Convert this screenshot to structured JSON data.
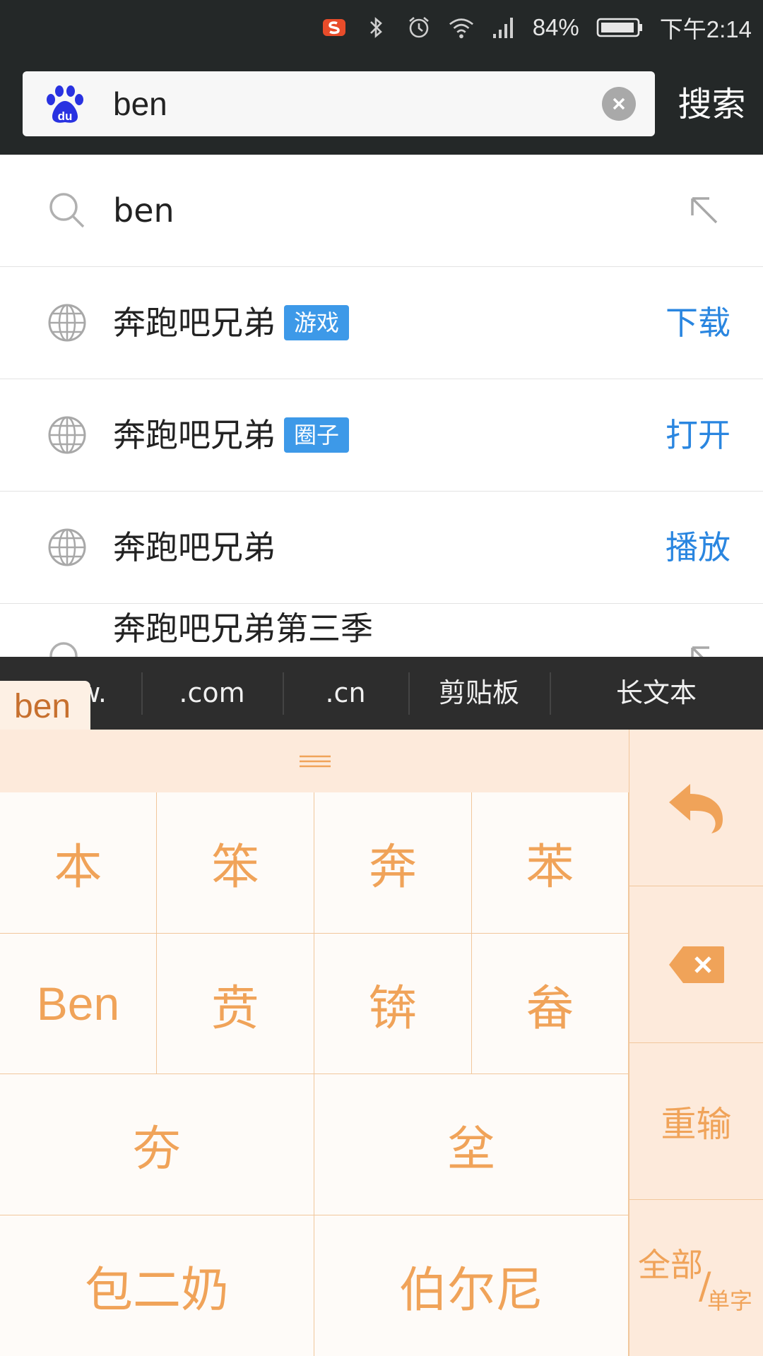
{
  "status_bar": {
    "battery_percent": "84%",
    "time": "下午2:14"
  },
  "search": {
    "query": "ben",
    "submit_label": "搜索"
  },
  "suggestions": [
    {
      "text": "ben",
      "tag": "",
      "action": "",
      "icon": "search-icon"
    },
    {
      "text": "奔跑吧兄弟",
      "tag": "游戏",
      "action": "下载",
      "icon": "globe-icon"
    },
    {
      "text": "奔跑吧兄弟",
      "tag": "圈子",
      "action": "打开",
      "icon": "globe-icon"
    },
    {
      "text": "奔跑吧兄弟",
      "tag": "",
      "action": "播放",
      "icon": "globe-icon"
    },
    {
      "text": "奔跑吧兄弟第三季",
      "tag": "",
      "action": "",
      "icon": "search-icon"
    }
  ],
  "ime": {
    "composition": "ben",
    "quick_bar": [
      "www.",
      ".com",
      ".cn",
      "剪贴板",
      "长文本"
    ],
    "candidates_row1": [
      "本",
      "笨",
      "奔",
      "苯"
    ],
    "candidates_row2": [
      "Ben",
      "贲",
      "锛",
      "畚"
    ],
    "candidates_row3": [
      "夯",
      "坌"
    ],
    "candidates_row4": [
      "包二奶",
      "伯尔尼"
    ],
    "side_keys": {
      "reset": "重输",
      "toggle_main": "全部",
      "toggle_sub": "单字"
    },
    "accent_color": "#f0a359"
  }
}
